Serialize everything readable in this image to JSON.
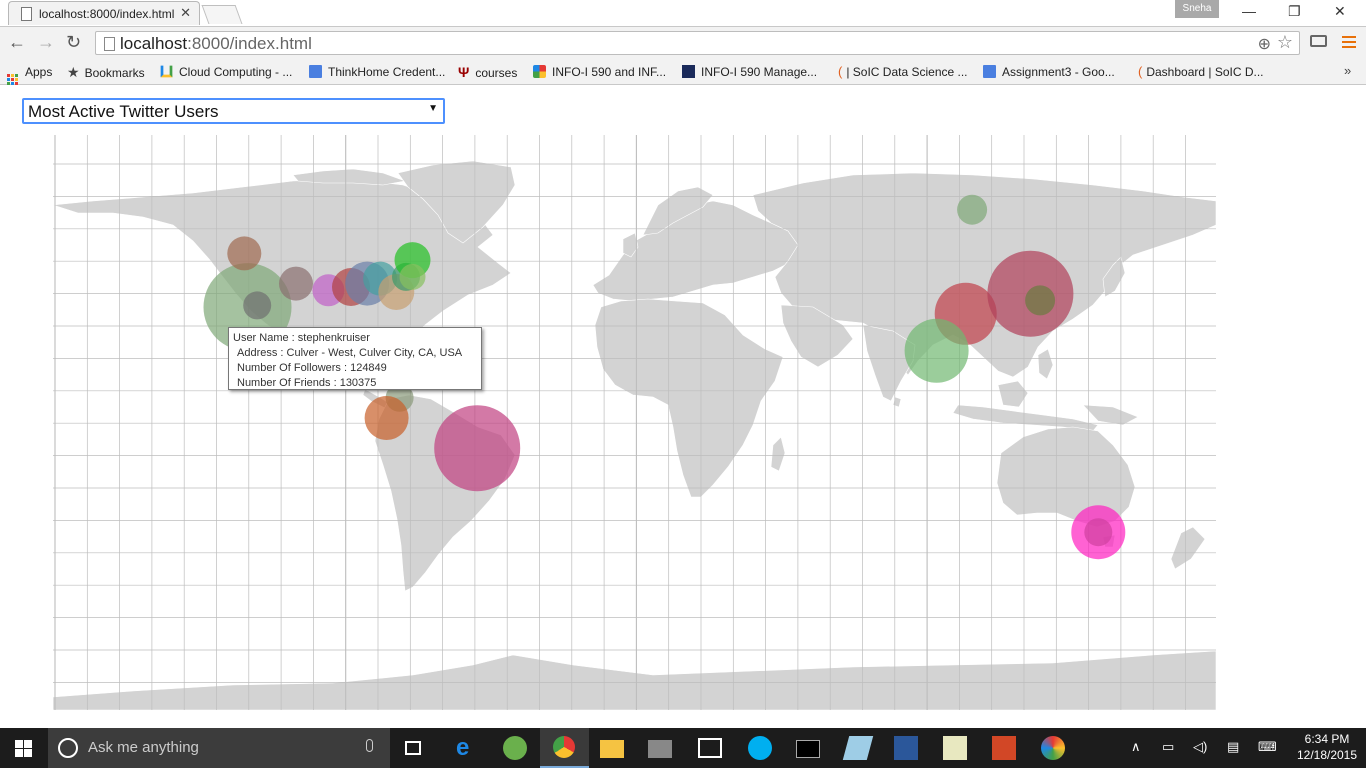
{
  "browser": {
    "tab_title": "localhost:8000/index.html",
    "profile_name": "Sneha",
    "url_host": "localhost",
    "url_rest": ":8000/index.html",
    "bookmarks": [
      {
        "label": "Apps",
        "icon": "apps-grid-icon"
      },
      {
        "label": "Bookmarks",
        "icon": "star-icon"
      },
      {
        "label": "Cloud Computing - ...",
        "icon": "drive-icon"
      },
      {
        "label": "ThinkHome Credent...",
        "icon": "docs-icon"
      },
      {
        "label": "courses",
        "icon": "iu-trident-icon"
      },
      {
        "label": "INFO-I 590 and INF...",
        "icon": "google-icon"
      },
      {
        "label": "INFO-I 590 Manage...",
        "icon": "app-icon"
      },
      {
        "label": "| SoIC Data Science ...",
        "icon": "canvas-icon"
      },
      {
        "label": "Assignment3 - Goo...",
        "icon": "docs-icon"
      },
      {
        "label": "Dashboard | SoIC D...",
        "icon": "canvas-icon"
      }
    ]
  },
  "page": {
    "dropdown_value": "Most Active Twitter Users",
    "tooltip": {
      "user_name": "User Name : stephenkruiser",
      "address": "Address : Culver - West, Culver City, CA, USA",
      "followers": "Number Of Followers : 124849",
      "friends": "Number Of Friends : 130375"
    }
  },
  "map": {
    "land_color": "#d3d3d3",
    "grid_color": "#bdbdbd",
    "bubbles": [
      {
        "lon": -117.0,
        "lat": 33.0,
        "r": 44,
        "color": "#7fa878"
      },
      {
        "lon": -118.0,
        "lat": 49.0,
        "r": 17,
        "color": "#a06a50"
      },
      {
        "lon": -102.0,
        "lat": 40.0,
        "r": 17,
        "color": "#8a6f6f"
      },
      {
        "lon": -114.0,
        "lat": 33.5,
        "r": 14,
        "color": "#6f6f6f"
      },
      {
        "lon": -92.0,
        "lat": 38.0,
        "r": 16,
        "color": "#c060c8"
      },
      {
        "lon": -85.0,
        "lat": 39.0,
        "r": 19,
        "color": "#b04040"
      },
      {
        "lon": -80.0,
        "lat": 40.0,
        "r": 22,
        "color": "#6a7fa8"
      },
      {
        "lon": -76.0,
        "lat": 41.5,
        "r": 17,
        "color": "#44a0a0"
      },
      {
        "lon": -71.0,
        "lat": 37.5,
        "r": 18,
        "color": "#c8a070"
      },
      {
        "lon": -68.0,
        "lat": 42.0,
        "r": 14,
        "color": "#3a9a6a"
      },
      {
        "lon": -66.0,
        "lat": 47.0,
        "r": 18,
        "color": "#22c022"
      },
      {
        "lon": -66.0,
        "lat": 42.0,
        "r": 13,
        "color": "#88c060"
      },
      {
        "lon": -70.0,
        "lat": 6.0,
        "r": 14,
        "color": "#8a9a7a"
      },
      {
        "lon": -74.0,
        "lat": 0.0,
        "r": 22,
        "color": "#c8602a"
      },
      {
        "lon": -46.0,
        "lat": -9.0,
        "r": 43,
        "color": "#c04080"
      },
      {
        "lon": 107.0,
        "lat": 62.0,
        "r": 15,
        "color": "#7fa878"
      },
      {
        "lon": 105.0,
        "lat": 31.0,
        "r": 31,
        "color": "#c0404a"
      },
      {
        "lon": 96.0,
        "lat": 20.0,
        "r": 32,
        "color": "#70b870"
      },
      {
        "lon": 125.0,
        "lat": 37.0,
        "r": 43,
        "color": "#b0405a"
      },
      {
        "lon": 128.0,
        "lat": 35.0,
        "r": 15,
        "color": "#6a7a40"
      },
      {
        "lon": 146.0,
        "lat": -34.0,
        "r": 27,
        "color": "#ff20c0"
      },
      {
        "lon": 146.0,
        "lat": -34.0,
        "r": 14,
        "color": "#d040a0"
      }
    ]
  },
  "taskbar": {
    "search_placeholder": "Ask me anything",
    "time": "6:34 PM",
    "date": "12/18/2015"
  }
}
